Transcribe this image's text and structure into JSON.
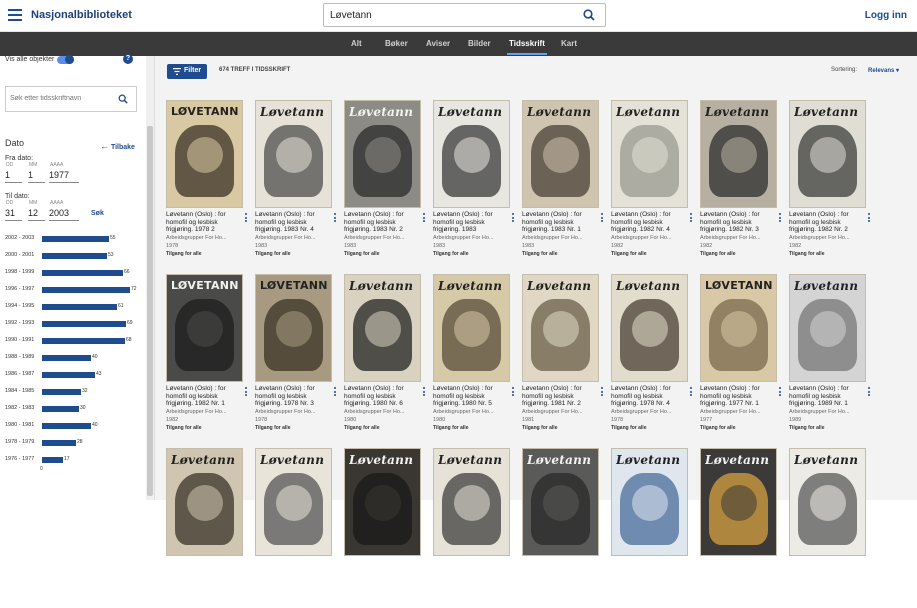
{
  "header": {
    "brand": "Nasjonalbiblioteket",
    "search_value": "Løvetann",
    "login": "Logg inn"
  },
  "tabs": [
    {
      "label": "Alt",
      "active": false
    },
    {
      "label": "Bøker",
      "active": false
    },
    {
      "label": "Aviser",
      "active": false
    },
    {
      "label": "Bilder",
      "active": false
    },
    {
      "label": "Tidsskrift",
      "active": true
    },
    {
      "label": "Kart",
      "active": false
    }
  ],
  "sidebar": {
    "show_all_label": "Vis alle objekter",
    "show_all_on": true,
    "journal_search_placeholder": "Søk etter tidsskriftnavn",
    "dato_title": "Dato",
    "back_label": "Tilbake",
    "from_label": "Fra dato:",
    "to_label": "Til dato:",
    "dd": "DD",
    "mm": "MM",
    "yyyy": "AAAA",
    "from": {
      "day": "1",
      "month": "1",
      "year": "1977"
    },
    "to": {
      "day": "31",
      "month": "12",
      "year": "2003"
    },
    "search_label": "Søk",
    "histogram_zero": "0",
    "histogram": [
      {
        "label": "2002 - 2003",
        "value": 55
      },
      {
        "label": "2000 - 2001",
        "value": 53
      },
      {
        "label": "1998 - 1999",
        "value": 66
      },
      {
        "label": "1996 - 1997",
        "value": 72
      },
      {
        "label": "1994 - 1995",
        "value": 61
      },
      {
        "label": "1992 - 1993",
        "value": 69
      },
      {
        "label": "1990 - 1991",
        "value": 68
      },
      {
        "label": "1988 - 1989",
        "value": 40
      },
      {
        "label": "1986 - 1987",
        "value": 43
      },
      {
        "label": "1984 - 1985",
        "value": 32
      },
      {
        "label": "1982 - 1983",
        "value": 30
      },
      {
        "label": "1980 - 1981",
        "value": 40
      },
      {
        "label": "1978 - 1979",
        "value": 28
      },
      {
        "label": "1976 - 1977",
        "value": 17
      }
    ]
  },
  "results": {
    "filter_label": "Filter",
    "hits_label": "674 TREFF I TIDSSKRIFT",
    "sort_label": "Sortering:",
    "sort_value": "Relevans",
    "items": [
      {
        "title": "Løvetann (Oslo) : for homofil og lesbisk frigjøring. 1978 2",
        "publisher": "Arbeidsgrupper For Ho...",
        "year": "1978",
        "access": "Tilgang for alle",
        "mast": "LØVETANN",
        "bg": "#d8c9a3",
        "art": "#3b3024",
        "block": true
      },
      {
        "title": "Løvetann (Oslo) : for homofil og lesbisk frigjøring. 1983 Nr. 4",
        "publisher": "Arbeidsgrupper For Ho...",
        "year": "1983",
        "access": "Tilgang for alle",
        "mast": "Løvetann",
        "bg": "#e6e2d8",
        "art": "#4d4d4d",
        "block": false
      },
      {
        "title": "Løvetann (Oslo) : for homofil og lesbisk frigjøring. 1983 Nr. 2",
        "publisher": "Arbeidsgrupper For Ho...",
        "year": "1983",
        "access": "Tilgang for alle",
        "mast": "Løvetann",
        "bg": "#8d8b86",
        "art": "#2b2b2b",
        "block": false
      },
      {
        "title": "Løvetann (Oslo) : for homofil og lesbisk frigjøring. 1983",
        "publisher": "Arbeidsgrupper For Ho...",
        "year": "1983",
        "access": "Tilgang for alle",
        "mast": "Løvetann",
        "bg": "#e8e6e0",
        "art": "#3a3a3a",
        "block": false
      },
      {
        "title": "Løvetann (Oslo) : for homofil og lesbisk frigjøring. 1983 Nr. 1",
        "publisher": "Arbeidsgrupper For Ho...",
        "year": "1983",
        "access": "Tilgang for alle",
        "mast": "Løvetann",
        "bg": "#cfc4b0",
        "art": "#4a4036",
        "block": false
      },
      {
        "title": "Løvetann (Oslo) : for homofil og lesbisk frigjøring. 1982 Nr. 4",
        "publisher": "Arbeidsgrupper For Ho...",
        "year": "1982",
        "access": "Tilgang for alle",
        "mast": "Løvetann",
        "bg": "#e4e1d6",
        "art": "#9a9a90",
        "block": false
      },
      {
        "title": "Løvetann (Oslo) : for homofil og lesbisk frigjøring. 1982 Nr. 3",
        "publisher": "Arbeidsgrupper For Ho...",
        "year": "1982",
        "access": "Tilgang for alle",
        "mast": "Løvetann",
        "bg": "#b7b0a2",
        "art": "#2e2e2e",
        "block": false
      },
      {
        "title": "Løvetann (Oslo) : for homofil og lesbisk frigjøring. 1982 Nr. 2",
        "publisher": "Arbeidsgrupper For Ho...",
        "year": "1982",
        "access": "Tilgang for alle",
        "mast": "Løvetann",
        "bg": "#e0ddd4",
        "art": "#3c3c3c",
        "block": false
      },
      {
        "title": "Løvetann (Oslo) : for homofil og lesbisk frigjøring. 1982 Nr. 1",
        "publisher": "Arbeidsgrupper For Ho...",
        "year": "1982",
        "access": "Tilgang for alle",
        "mast": "LØVETANN",
        "bg": "#4a4a48",
        "art": "#1e1e1e",
        "block": true
      },
      {
        "title": "Løvetann (Oslo) : for homofil og lesbisk frigjøring. 1978 Nr. 3",
        "publisher": "Arbeidsgrupper For Ho...",
        "year": "1978",
        "access": "Tilgang for alle",
        "mast": "LØVETANN",
        "bg": "#a89a80",
        "art": "#3a3226",
        "block": true
      },
      {
        "title": "Løvetann (Oslo) : for homofil og lesbisk frigjøring. 1980 Nr. 6",
        "publisher": "Arbeidsgrupper For Ho...",
        "year": "1980",
        "access": "Tilgang for alle",
        "mast": "Løvetann",
        "bg": "#d9d2c0",
        "art": "#222222",
        "block": false
      },
      {
        "title": "Løvetann (Oslo) : for homofil og lesbisk frigjøring. 1980 Nr. 5",
        "publisher": "Arbeidsgrupper For Ho...",
        "year": "1980",
        "access": "Tilgang for alle",
        "mast": "Løvetann",
        "bg": "#d6c9a8",
        "art": "#5a4c38",
        "block": false
      },
      {
        "title": "Løvetann (Oslo) : for homofil og lesbisk frigjøring. 1981 Nr. 2",
        "publisher": "Arbeidsgrupper For Ho...",
        "year": "1981",
        "access": "Tilgang for alle",
        "mast": "Løvetann",
        "bg": "#e0d8c4",
        "art": "#6b6048",
        "block": false
      },
      {
        "title": "Løvetann (Oslo) : for homofil og lesbisk frigjøring. 1978 Nr. 4",
        "publisher": "Arbeidsgrupper For Ho...",
        "year": "1978",
        "access": "Tilgang for alle",
        "mast": "Løvetann",
        "bg": "#e2dccc",
        "art": "#4a4034",
        "block": false
      },
      {
        "title": "Løvetann (Oslo) : for homofil og lesbisk frigjøring. 1977 Nr. 1",
        "publisher": "Arbeidsgrupper For Ho...",
        "year": "1977",
        "access": "Tilgang for alle",
        "mast": "LØVETANN",
        "bg": "#d9c8a6",
        "art": "#7a6a4c",
        "block": true
      },
      {
        "title": "Løvetann (Oslo) : for homofil og lesbisk frigjøring. 1989 Nr. 1",
        "publisher": "Arbeidsgrupper For Ho...",
        "year": "1989",
        "access": "Tilgang for alle",
        "mast": "Løvetann",
        "bg": "#d4d4d4",
        "art": "#777777",
        "block": false
      },
      {
        "mast": "Løvetann",
        "bg": "#cfc5b0",
        "art": "#3a3228",
        "block": false
      },
      {
        "mast": "Løvetann",
        "bg": "#e8e4da",
        "art": "#555555",
        "block": false
      },
      {
        "mast": "Løvetann",
        "bg": "#3a3632",
        "art": "#1a1a1a",
        "block": false
      },
      {
        "mast": "Løvetann",
        "bg": "#e6e2d8",
        "art": "#3d3d3d",
        "block": false
      },
      {
        "mast": "Løvetann",
        "bg": "#5a5a58",
        "art": "#2a2a2a",
        "block": false
      },
      {
        "mast": "Løvetann",
        "bg": "#dfe6ee",
        "art": "#4a6c9a",
        "block": false
      },
      {
        "mast": "Løvetann",
        "bg": "#3b3a38",
        "art": "#d7a040",
        "block": false
      },
      {
        "mast": "Løvetann",
        "bg": "#ecebe6",
        "art": "#5a5a5a",
        "block": false
      }
    ]
  }
}
